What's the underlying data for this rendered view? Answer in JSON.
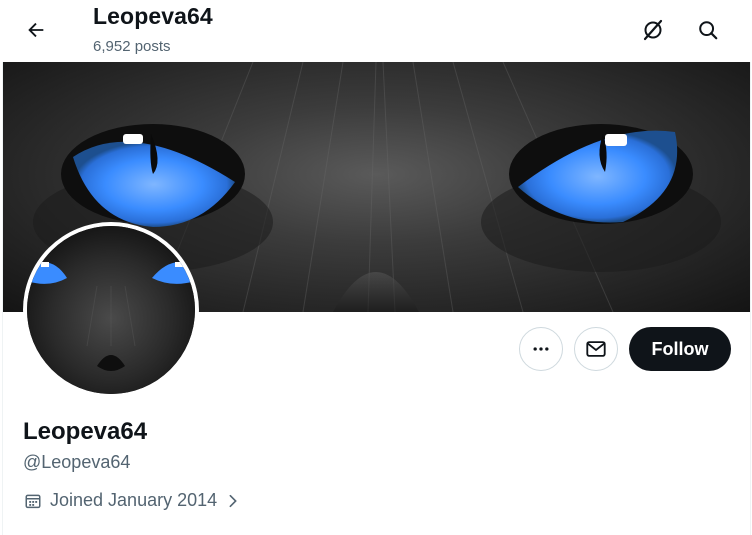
{
  "header": {
    "title": "Leopeva64",
    "posts_count": "6,952 posts",
    "back_icon": "arrow-left-icon",
    "grok_icon": "grok-icon",
    "search_icon": "search-icon"
  },
  "profile": {
    "display_name": "Leopeva64",
    "handle": "@Leopeva64",
    "joined": "Joined January 2014",
    "banner_description": "close-up of black cat with blue eyes",
    "avatar_description": "black cat with blue eyes"
  },
  "actions": {
    "more_icon": "more-horizontal-icon",
    "message_icon": "envelope-icon",
    "follow_label": "Follow"
  },
  "colors": {
    "text_primary": "#0f1419",
    "text_secondary": "#536471",
    "border": "#cfd9de",
    "eye_blue": "#3a8cff"
  }
}
